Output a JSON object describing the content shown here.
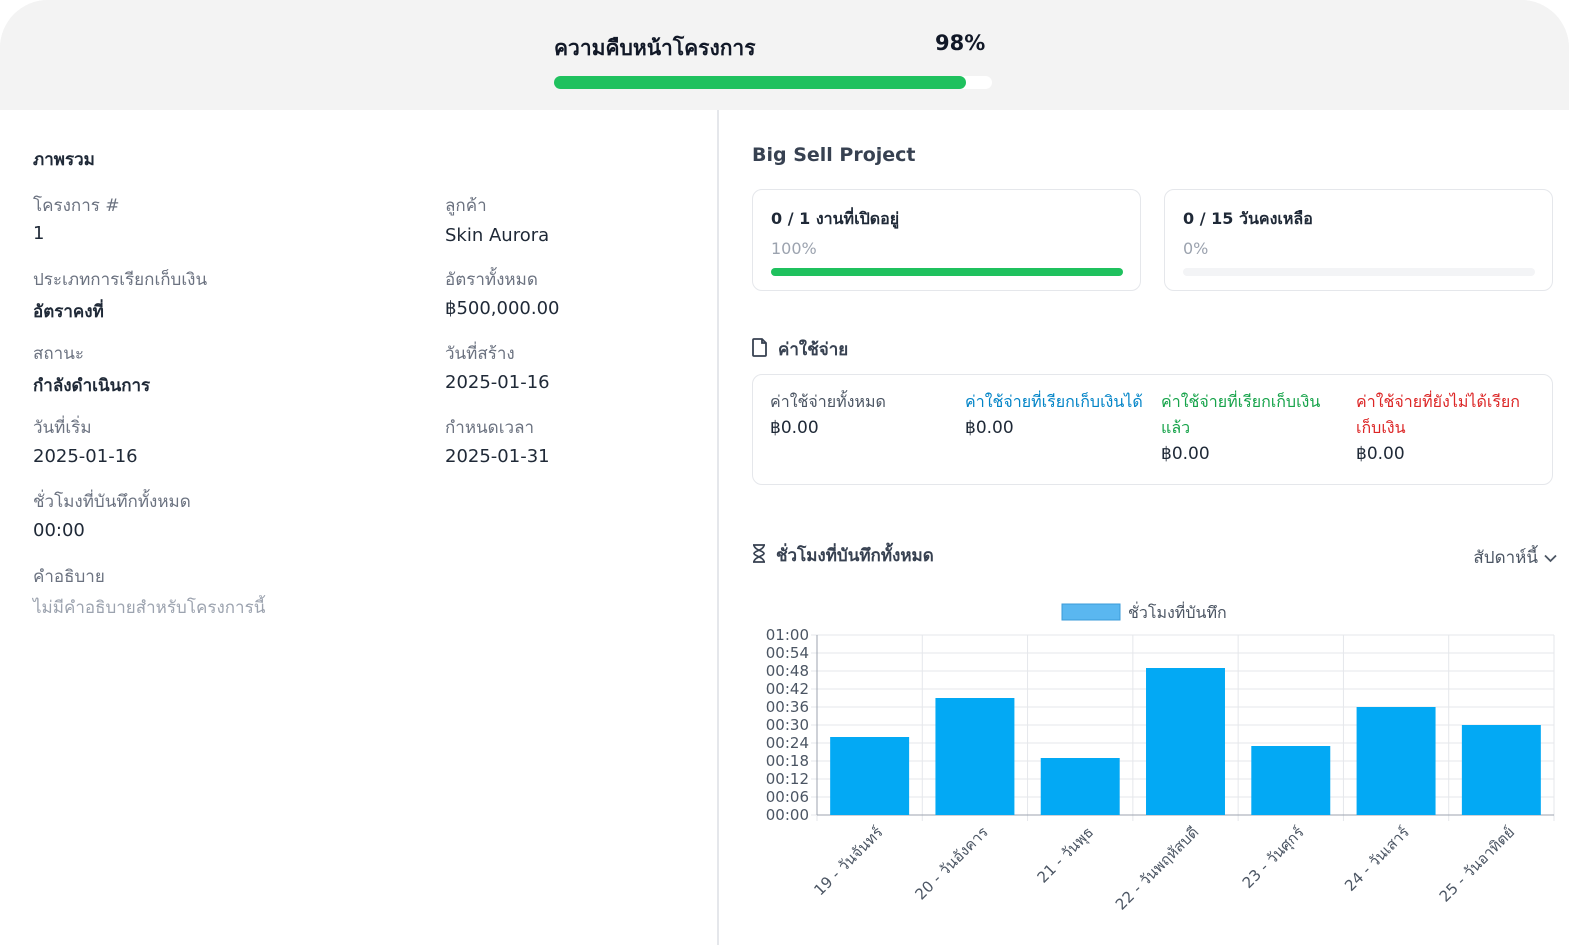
{
  "header": {
    "title": "ความคืบหน้าโครงการ",
    "percent_label": "98%",
    "percent_value": 0.94
  },
  "overview": {
    "title": "ภาพรวม",
    "project_no_label": "โครงการ #",
    "project_no": "1",
    "customer_label": "ลูกค้า",
    "customer": "Skin Aurora",
    "billing_type_label": "ประเภทการเรียกเก็บเงิน",
    "billing_type": "อัตราคงที่",
    "total_rate_label": "อัตราทั้งหมด",
    "total_rate": "฿500,000.00",
    "status_label": "สถานะ",
    "status": "กำลังดำเนินการ",
    "created_label": "วันที่สร้าง",
    "created": "2025-01-16",
    "start_label": "วันที่เริ่ม",
    "start": "2025-01-16",
    "deadline_label": "กำหนดเวลา",
    "deadline": "2025-01-31",
    "hours_label": "ชั่วโมงที่บันทึกทั้งหมด",
    "hours": "00:00",
    "desc_label": "คำอธิบาย",
    "desc": "ไม่มีคำอธิบายสำหรับโครงการนี้"
  },
  "project": {
    "name": "Big Sell Project",
    "tasks_card": {
      "title": "0 / 1 งานที่เปิดอยู่",
      "pct": "100%",
      "fill": 1.0
    },
    "days_card": {
      "title": "0 / 15 วันคงเหลือ",
      "pct": "0%",
      "fill": 0.0
    }
  },
  "expenses": {
    "title": "ค่าใช้จ่าย",
    "columns": [
      {
        "label": "ค่าใช้จ่ายทั้งหมด",
        "value": "฿0.00",
        "color": "#4b5563"
      },
      {
        "label": "ค่าใช้จ่ายที่เรียกเก็บเงินได้",
        "value": "฿0.00",
        "color": "#0284c7"
      },
      {
        "label": "ค่าใช้จ่ายที่เรียกเก็บเงินแล้ว",
        "value": "฿0.00",
        "color": "#16a34a"
      },
      {
        "label": "ค่าใช้จ่ายที่ยังไม่ได้เรียกเก็บเงิน",
        "value": "฿0.00",
        "color": "#dc2626"
      }
    ]
  },
  "hours_section": {
    "title": "ชั่วโมงที่บันทึกทั้งหมด",
    "range": "สัปดาห์นี้"
  },
  "chart_data": {
    "type": "bar",
    "legend": "ชั่วโมงที่บันทึก",
    "categories": [
      "19 - วันจันทร์",
      "20 - วันอังคาร",
      "21 - วันพุธ",
      "22 - วันพฤหัสบดี",
      "23 - วันศุกร์",
      "24 - วันเสาร์",
      "25 - วันอาทิตย์"
    ],
    "values_minutes": [
      26,
      39,
      19,
      49,
      23,
      36,
      30
    ],
    "y_ticks": [
      "00:00",
      "00:06",
      "00:12",
      "00:18",
      "00:24",
      "00:30",
      "00:36",
      "00:42",
      "00:48",
      "00:54",
      "01:00"
    ],
    "ylim_minutes": [
      0,
      60
    ],
    "bar_color": "#03a9f4",
    "legend_color": "#5ab7f0"
  }
}
